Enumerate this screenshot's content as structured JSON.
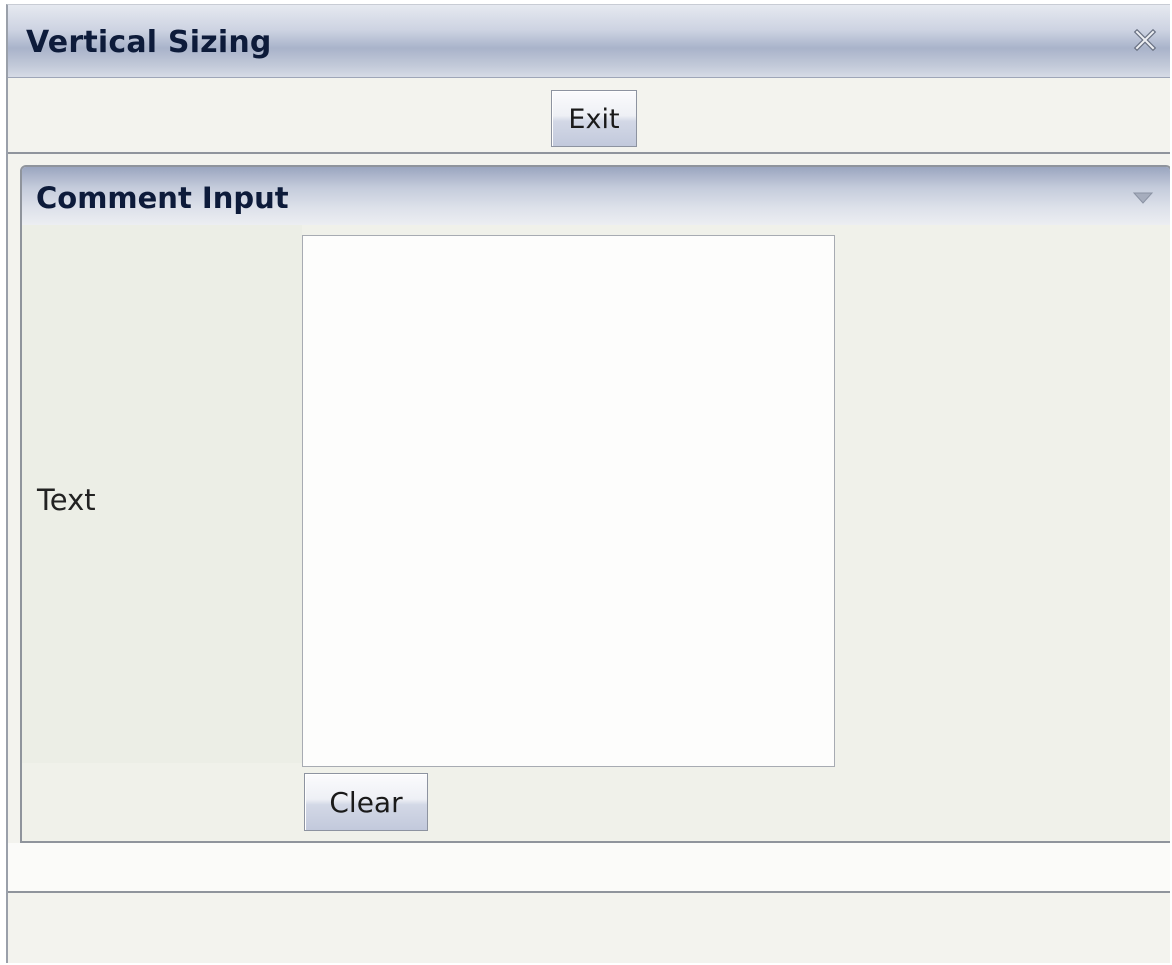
{
  "window": {
    "title": "Vertical Sizing",
    "close_icon": "close-icon"
  },
  "toolbar": {
    "exit_label": "Exit"
  },
  "panel": {
    "title": "Comment Input",
    "collapse_icon": "triangle-down-icon",
    "text_label": "Text",
    "text_value": "",
    "clear_label": "Clear"
  },
  "colors": {
    "title_text": "#0d1b3a",
    "header_gradient_mid": "#a9b3ca",
    "background": "#f3f3ee"
  }
}
